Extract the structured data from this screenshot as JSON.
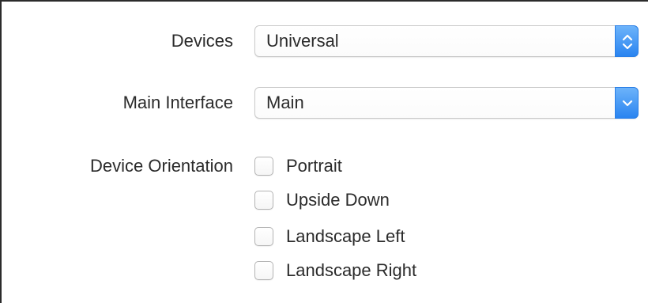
{
  "devices": {
    "label": "Devices",
    "value": "Universal",
    "control_icon": "up-down-chevron-icon"
  },
  "main_interface": {
    "label": "Main Interface",
    "value": "Main",
    "control_icon": "chevron-down-icon"
  },
  "device_orientation": {
    "label": "Device Orientation",
    "options": [
      {
        "label": "Portrait",
        "checked": false
      },
      {
        "label": "Upside Down",
        "checked": false
      },
      {
        "label": "Landscape Left",
        "checked": false
      },
      {
        "label": "Landscape Right",
        "checked": false
      }
    ]
  },
  "colors": {
    "accent": "#2a84f0",
    "text": "#2b2b2b",
    "border": "#c9c9c9"
  }
}
